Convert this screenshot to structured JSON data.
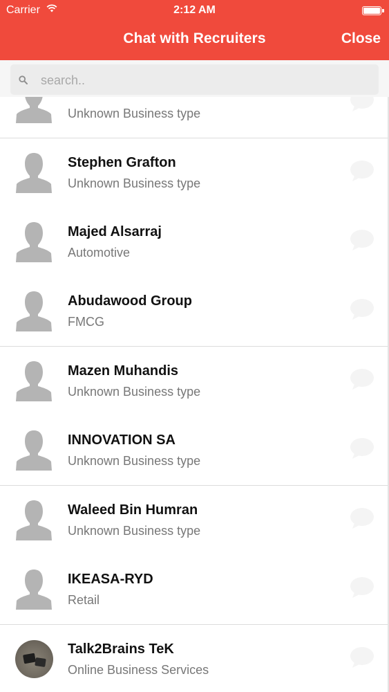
{
  "status_bar": {
    "carrier": "Carrier",
    "time": "2:12 AM"
  },
  "nav": {
    "title": "Chat with Recruiters",
    "close_label": "Close"
  },
  "search": {
    "placeholder": "search..",
    "value": ""
  },
  "colors": {
    "accent": "#f04a3c",
    "divider": "#dcdcdc",
    "subtitle": "#777777"
  },
  "recruiters": [
    {
      "name": "",
      "business_type": "Unknown Business type",
      "avatar": "person-placeholder-icon"
    },
    {
      "name": "Stephen Grafton",
      "business_type": "Unknown Business type",
      "avatar": "person-placeholder-icon"
    },
    {
      "name": "Majed Alsarraj",
      "business_type": "Automotive",
      "avatar": "person-placeholder-icon"
    },
    {
      "name": "Abudawood Group",
      "business_type": "FMCG",
      "avatar": "person-placeholder-icon"
    },
    {
      "name": "Mazen Muhandis",
      "business_type": "Unknown Business type",
      "avatar": "person-placeholder-icon"
    },
    {
      "name": "INNOVATION SA",
      "business_type": "Unknown Business type",
      "avatar": "person-placeholder-icon"
    },
    {
      "name": "Waleed Bin Humran",
      "business_type": "Unknown Business type",
      "avatar": "person-placeholder-icon"
    },
    {
      "name": "IKEASA-RYD",
      "business_type": "Retail",
      "avatar": "person-placeholder-icon"
    },
    {
      "name": "Talk2Brains TeK",
      "business_type": "Online Business Services",
      "avatar": "photo-avatar"
    }
  ]
}
